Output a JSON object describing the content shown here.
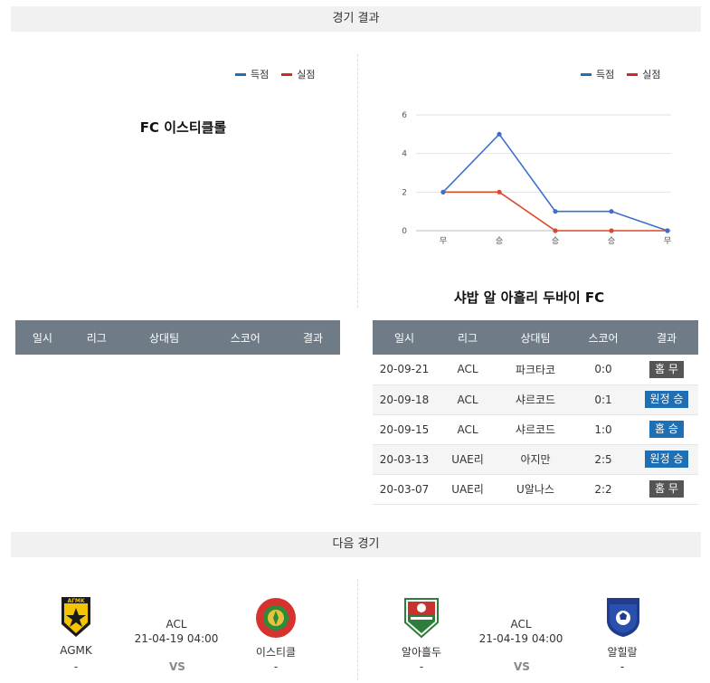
{
  "sections": {
    "results_title": "경기 결과",
    "next_title": "다음 경기"
  },
  "legend": {
    "scored": "득점",
    "conceded": "실점",
    "scored_color": "#1e6fb4",
    "conceded_color": "#d12a1f"
  },
  "left_team": {
    "name": "FC 이스티클롤",
    "table_headers": [
      "일시",
      "리그",
      "상대팀",
      "스코어",
      "결과"
    ]
  },
  "right_team": {
    "name": "샤밥 알 아흘리 두바이 FC",
    "table_headers": [
      "일시",
      "리그",
      "상대팀",
      "스코어",
      "결과"
    ],
    "rows": [
      {
        "date": "20-09-21",
        "league": "ACL",
        "opponent": "파크타코",
        "score": "0:0",
        "result": "홈 무",
        "kind": "draw"
      },
      {
        "date": "20-09-18",
        "league": "ACL",
        "opponent": "샤르코드",
        "score": "0:1",
        "result": "원정 승",
        "kind": "win"
      },
      {
        "date": "20-09-15",
        "league": "ACL",
        "opponent": "샤르코드",
        "score": "1:0",
        "result": "홈 승",
        "kind": "win"
      },
      {
        "date": "20-03-13",
        "league": "UAE리",
        "opponent": "아지만",
        "score": "2:5",
        "result": "원정 승",
        "kind": "win"
      },
      {
        "date": "20-03-07",
        "league": "UAE리",
        "opponent": "U알나스",
        "score": "2:2",
        "result": "홈 무",
        "kind": "draw"
      }
    ]
  },
  "chart_data": {
    "type": "line",
    "categories": [
      "무",
      "승",
      "승",
      "승",
      "무"
    ],
    "yticks": [
      0,
      2,
      4,
      6
    ],
    "ylim": [
      0,
      6
    ],
    "series": [
      {
        "name": "득점",
        "color": "#3c6fca",
        "values": [
          2,
          5,
          1,
          1,
          0
        ]
      },
      {
        "name": "실점",
        "color": "#d84a2a",
        "values": [
          2,
          2,
          0,
          0,
          0
        ]
      }
    ]
  },
  "next_matches": [
    {
      "home": "AGMK",
      "home_score": "-",
      "away": "이스티클",
      "away_score": "-",
      "league": "ACL",
      "datetime": "21-04-19 04:00",
      "vs": "VS"
    },
    {
      "home": "알아흘두",
      "home_score": "-",
      "away": "알힐랄",
      "away_score": "-",
      "league": "ACL",
      "datetime": "21-04-19 04:00",
      "vs": "VS"
    }
  ]
}
